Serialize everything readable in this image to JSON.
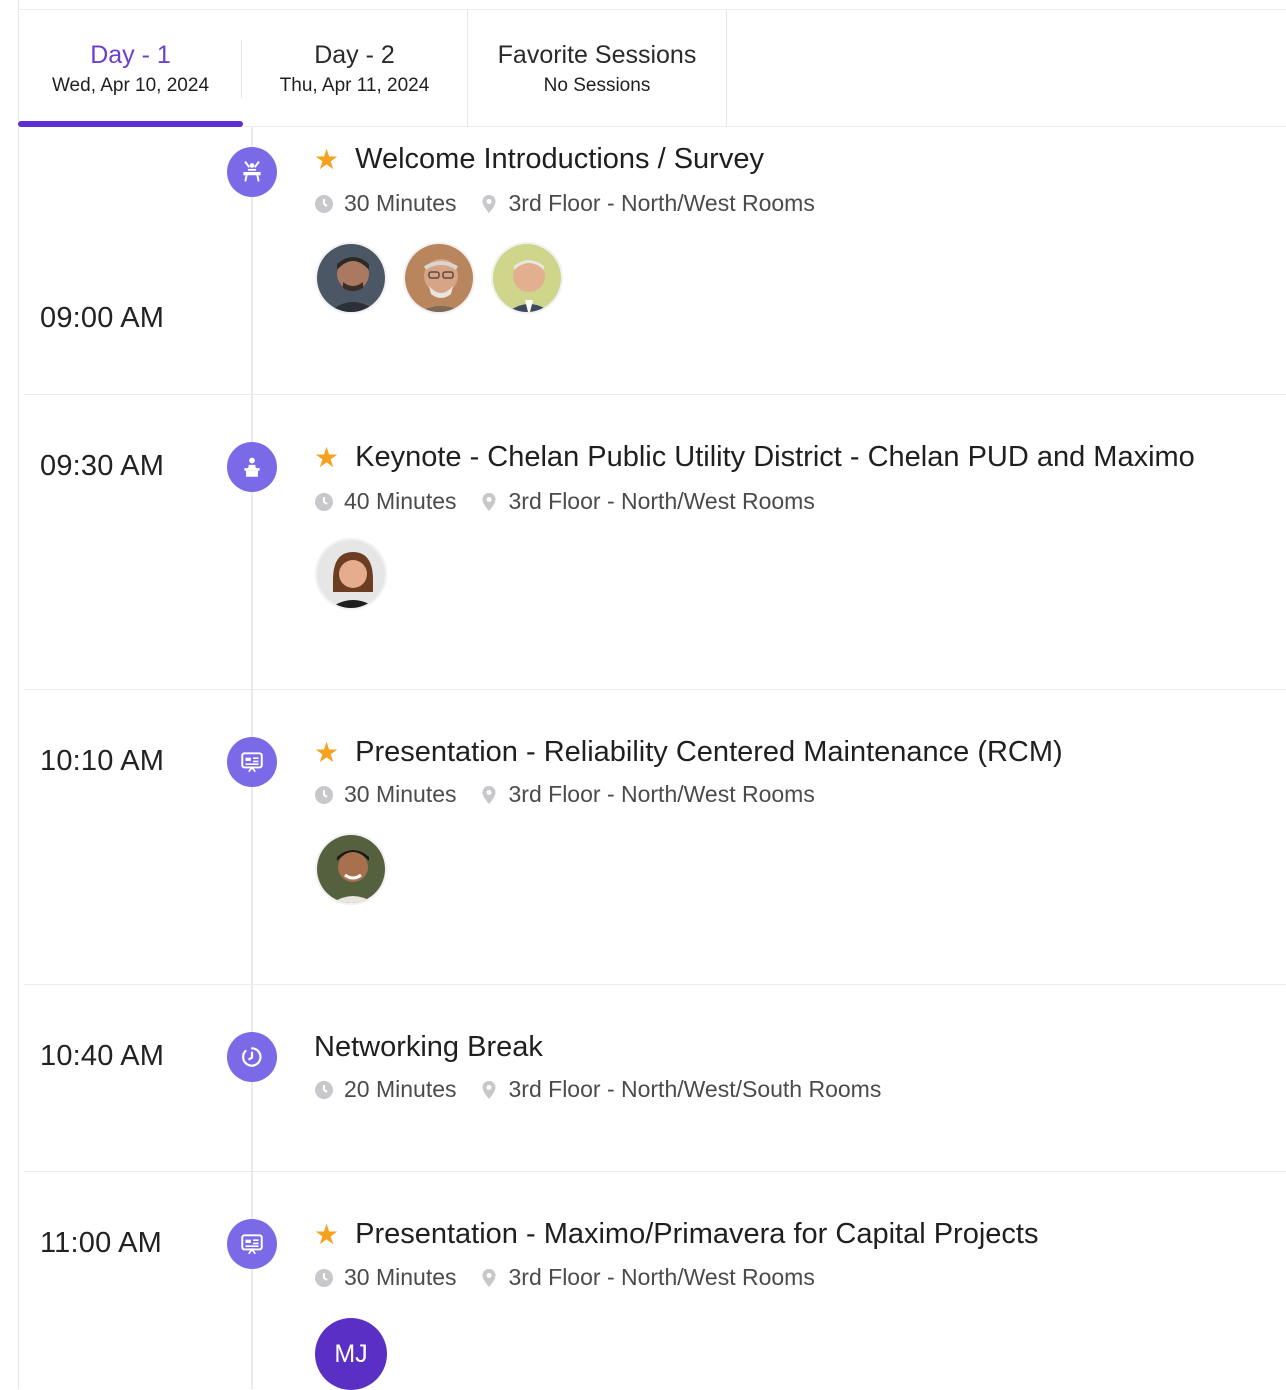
{
  "tabs": [
    {
      "title": "Day - 1",
      "subtitle": "Wed, Apr 10, 2024",
      "active": true
    },
    {
      "title": "Day - 2",
      "subtitle": "Thu, Apr 11, 2024",
      "active": false
    },
    {
      "title": "Favorite Sessions",
      "subtitle": "No Sessions",
      "active": false
    }
  ],
  "colors": {
    "accent": "#5b2fd1",
    "node": "#7b6ae8",
    "star": "#f6a21e"
  },
  "sessions": [
    {
      "time": "09:00 AM",
      "icon": "podium-speaker-icon",
      "favorite": true,
      "title": "Welcome Introductions / Survey",
      "duration": "30 Minutes",
      "location": "3rd Floor - North/West Rooms",
      "speakers": [
        "speaker-photo",
        "speaker-photo",
        "speaker-photo"
      ]
    },
    {
      "time": "09:30 AM",
      "icon": "keynote-speaker-icon",
      "favorite": true,
      "title": "Keynote - Chelan Public Utility District - Chelan PUD and Maximo",
      "duration": "40 Minutes",
      "location": "3rd Floor - North/West Rooms",
      "speakers": [
        "speaker-photo"
      ]
    },
    {
      "time": "10:10 AM",
      "icon": "presentation-icon",
      "favorite": true,
      "title": "Presentation - Reliability Centered Maintenance (RCM)",
      "duration": "30 Minutes",
      "location": "3rd Floor - North/West Rooms",
      "speakers": [
        "speaker-photo"
      ]
    },
    {
      "time": "10:40 AM",
      "icon": "break-clock-icon",
      "favorite": false,
      "title": "Networking Break",
      "duration": "20 Minutes",
      "location": "3rd Floor - North/West/South Rooms",
      "speakers": []
    },
    {
      "time": "11:00 AM",
      "icon": "presentation-icon",
      "favorite": true,
      "title": "Presentation - Maximo/Primavera for Capital Projects",
      "duration": "30 Minutes",
      "location": "3rd Floor - North/West Rooms",
      "speakers": [
        "MJ"
      ]
    }
  ]
}
